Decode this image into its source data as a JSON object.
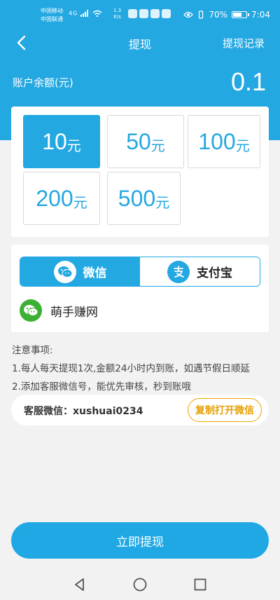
{
  "status_bar": {
    "carrier1": "中国移动",
    "carrier2": "中国联通",
    "network": "4G",
    "speed_value": "1.3",
    "speed_unit": "K/s",
    "battery_percent": "70%",
    "battery_level": 0.7,
    "time": "7:04"
  },
  "header": {
    "title": "提现",
    "record_link": "提现记录",
    "back_icon": "chevron-left-icon"
  },
  "balance": {
    "label": "账户余额(元)",
    "value": "0.1"
  },
  "amounts": {
    "unit": "元",
    "options": [
      {
        "value": "10",
        "selected": true
      },
      {
        "value": "50",
        "selected": false
      },
      {
        "value": "100",
        "selected": false
      },
      {
        "value": "200",
        "selected": false
      },
      {
        "value": "500",
        "selected": false
      }
    ]
  },
  "payment": {
    "wechat_label": "微信",
    "alipay_label": "支付宝",
    "selected": "wechat",
    "account_name": "萌手赚网"
  },
  "notes": {
    "title": "注意事项:",
    "line1": "1.每人每天提现1次,金额24小时内到账，如遇节假日顺延",
    "line2": "2.添加客服微信号，能优先审核，秒到账哦"
  },
  "service": {
    "label": "客服微信：xushuai0234",
    "copy_button": "复制打开微信"
  },
  "submit_button": "立即提现",
  "colors": {
    "primary": "#24a8e2",
    "accent_orange": "#e6a000",
    "wechat_green": "#3cb034"
  }
}
